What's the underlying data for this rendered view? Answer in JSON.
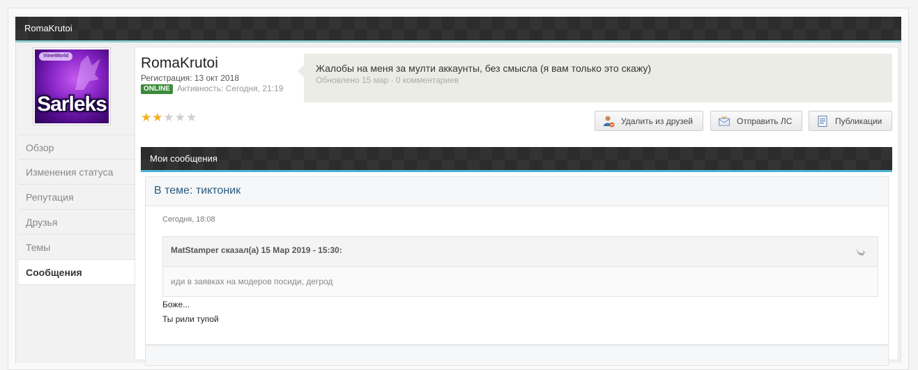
{
  "window": {
    "title": "RomaKrutoi"
  },
  "avatar": {
    "badge": "VimeWorld",
    "name": "Sarleks"
  },
  "nav": {
    "items": [
      {
        "label": "Обзор",
        "active": false
      },
      {
        "label": "Изменения статуса",
        "active": false
      },
      {
        "label": "Репутация",
        "active": false
      },
      {
        "label": "Друзья",
        "active": false
      },
      {
        "label": "Темы",
        "active": false
      },
      {
        "label": "Сообщения",
        "active": true
      }
    ]
  },
  "profile": {
    "username": "RomaKrutoi",
    "registration": "Регистрация: 13 окт 2018",
    "online_badge": "ONLINE",
    "activity": "Активность: Сегодня, 21:19",
    "rating": {
      "value": 2,
      "max": 5
    }
  },
  "status": {
    "text": "Жалобы на меня за мулти аккаунты, без смысла (я вам только это скажу)",
    "meta": "Обновлено 15 мар · 0 комментариев"
  },
  "buttons": {
    "unfriend": "Удалить из друзей",
    "pm": "Отправить ЛС",
    "publications": "Публикации"
  },
  "section": {
    "title": "Мои сообщения"
  },
  "post": {
    "topic": "В теме: тиктоник",
    "date": "Сегодня, 18:08",
    "quote_author": "MatStamper сказал(а) 15 Мар 2019 - 15:30:",
    "quote_text": "иди в заявках на модеров посиди, дегрод",
    "line1": "Боже...",
    "line2": "Ты рили тупой"
  },
  "colors": {
    "online": "#3c8b3c",
    "star_on": "#f2b01e",
    "topic_link": "#2a5c80",
    "section_accent": "#4bb3d4"
  }
}
